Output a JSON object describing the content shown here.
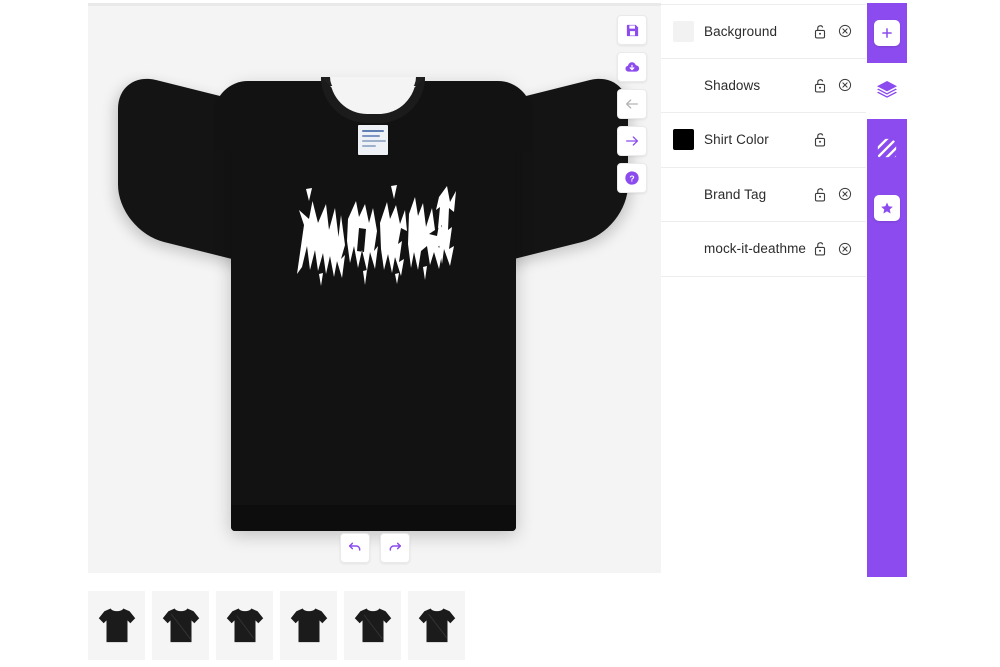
{
  "app": {
    "accent_color": "#8b4bee",
    "canvas_background": "#f4f4f4",
    "shirt_color": "#121212"
  },
  "canvas": {
    "name": "mockup-canvas",
    "artwork_text": "MOCKIT",
    "artwork_style": "deathmetal"
  },
  "action_rail": {
    "buttons": [
      {
        "name": "save-button",
        "icon": "floppy-disk-icon",
        "label": "Save",
        "state": "enabled"
      },
      {
        "name": "download-button",
        "icon": "cloud-download-icon",
        "label": "Download",
        "state": "enabled"
      },
      {
        "name": "previous-button",
        "icon": "arrow-left-icon",
        "label": "Previous",
        "state": "disabled"
      },
      {
        "name": "next-button",
        "icon": "arrow-right-icon",
        "label": "Next",
        "state": "enabled"
      },
      {
        "name": "help-button",
        "icon": "question-mark-icon",
        "label": "Help",
        "state": "enabled"
      }
    ]
  },
  "history": {
    "undo_label": "Undo",
    "redo_label": "Redo"
  },
  "layers": {
    "panel_label": "Layers",
    "rows": [
      {
        "label": "Background",
        "swatch": "#f2f2f2",
        "has_swatch": true,
        "lock": "unlocked",
        "has_delete": true
      },
      {
        "label": "Shadows",
        "swatch": "",
        "has_swatch": false,
        "lock": "unlocked",
        "has_delete": true
      },
      {
        "label": "Shirt Color",
        "swatch": "#000000",
        "has_swatch": true,
        "lock": "unlocked",
        "has_delete": false
      },
      {
        "label": "Brand Tag",
        "swatch": "",
        "has_swatch": false,
        "lock": "unlocked",
        "has_delete": true
      },
      {
        "label": "mock-it-deathme",
        "swatch": "",
        "has_swatch": false,
        "lock": "unlocked",
        "has_delete": true
      }
    ]
  },
  "tool_sidebar": {
    "buttons": [
      {
        "name": "add-layer-button",
        "icon": "plus-icon",
        "label": "Add",
        "active": true
      },
      {
        "name": "layers-button",
        "icon": "layers-icon",
        "label": "Layers",
        "active": false
      },
      {
        "name": "pattern-button",
        "icon": "pattern-icon",
        "label": "Patterns",
        "active": true
      },
      {
        "name": "favorites-button",
        "icon": "star-icon",
        "label": "Favorites",
        "active": true
      }
    ]
  },
  "thumbnails": {
    "label": "Mockup views",
    "items": [
      {
        "name": "thumbnail-view-1",
        "selected": true
      },
      {
        "name": "thumbnail-view-2",
        "selected": false
      },
      {
        "name": "thumbnail-view-3",
        "selected": false
      },
      {
        "name": "thumbnail-view-4",
        "selected": false
      },
      {
        "name": "thumbnail-view-5",
        "selected": false
      },
      {
        "name": "thumbnail-view-6",
        "selected": false
      }
    ]
  }
}
